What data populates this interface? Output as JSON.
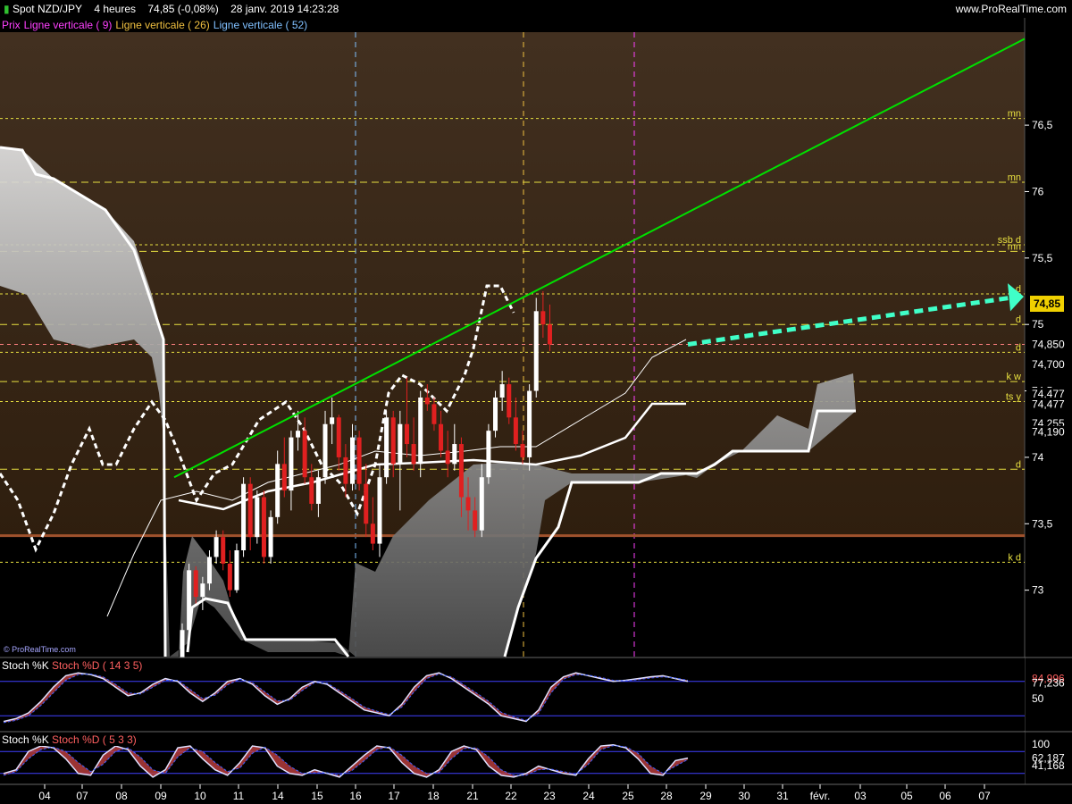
{
  "header": {
    "instrument": "Spot NZD/JPY",
    "timeframe": "4 heures",
    "last": "74,85 (-0,08%)",
    "datetime": "28 janv. 2019 14:23:28",
    "site": "www.ProRealTime.com",
    "watermark": "© ProRealTime.com"
  },
  "legend": [
    {
      "label": "Prix",
      "color": "#ff40ff"
    },
    {
      "label": "Ligne verticale ( 9)",
      "color": "#ff40ff"
    },
    {
      "label": "Ligne verticale ( 26)",
      "color": "#f0c040"
    },
    {
      "label": "Ligne verticale ( 52)",
      "color": "#80c0ff"
    }
  ],
  "current_price_badge": "74,85",
  "colors": {
    "candle_up": "#ffffff",
    "candle_down": "#e02020",
    "trendline": "#00e000",
    "projection_arrow": "#40ffc8",
    "support_line": "#a0522d",
    "level_lines": "#e8e040",
    "cloud": "#c8c8c8"
  },
  "chart_data": [
    {
      "type": "line",
      "panel": "price",
      "ylim": [
        72.5,
        77.2
      ],
      "y_ticks": [
        {
          "value": 76.5,
          "label": "76,5"
        },
        {
          "value": 76,
          "label": "76"
        },
        {
          "value": 75.5,
          "label": "75,5"
        },
        {
          "value": 75,
          "label": "75"
        },
        {
          "value": 74.5,
          "label": "74,5"
        },
        {
          "value": 74,
          "label": "74"
        },
        {
          "value": 73.5,
          "label": "73,5"
        },
        {
          "value": 73,
          "label": "73"
        }
      ],
      "axis_labels": [
        {
          "value": 74.85,
          "label": "74,850"
        },
        {
          "value": 74.7,
          "label": "74,700"
        },
        {
          "value": 74.477,
          "label": "74,477"
        },
        {
          "value": 74.4,
          "label": "74,477"
        },
        {
          "value": 74.255,
          "label": "74,255"
        },
        {
          "value": 74.19,
          "label": "74,190"
        }
      ],
      "level_lines": [
        {
          "value": 76.55,
          "label": "mn"
        },
        {
          "value": 76.07,
          "label": "mn"
        },
        {
          "value": 75.6,
          "label": "ssb d"
        },
        {
          "value": 75.55,
          "label": "mn"
        },
        {
          "value": 75.23,
          "label": "d"
        },
        {
          "value": 75.0,
          "label": "d"
        },
        {
          "value": 74.79,
          "label": "d"
        },
        {
          "value": 74.57,
          "label": "k w"
        },
        {
          "value": 74.42,
          "label": "ts y"
        },
        {
          "value": 73.91,
          "label": "d"
        },
        {
          "value": 73.21,
          "label": "k d"
        }
      ],
      "support_level": 73.41,
      "current_price": 74.85,
      "x_categories": [
        "04",
        "07",
        "08",
        "09",
        "10",
        "11",
        "14",
        "15",
        "16",
        "17",
        "18",
        "21",
        "22",
        "23",
        "24",
        "25",
        "28",
        "29",
        "30",
        "31",
        "févr.",
        "03",
        "05",
        "06",
        "07"
      ],
      "ohlc": [
        [
          72.45,
          72.75,
          72.42,
          72.7
        ],
        [
          72.7,
          73.2,
          72.6,
          73.15
        ],
        [
          73.15,
          73.18,
          72.9,
          72.95
        ],
        [
          72.95,
          73.1,
          72.85,
          73.05
        ],
        [
          73.05,
          73.3,
          73.0,
          73.25
        ],
        [
          73.25,
          73.45,
          73.2,
          73.4
        ],
        [
          73.4,
          73.45,
          73.15,
          73.2
        ],
        [
          73.2,
          73.3,
          72.95,
          73.0
        ],
        [
          73.0,
          73.35,
          72.98,
          73.3
        ],
        [
          73.3,
          73.85,
          73.25,
          73.8
        ],
        [
          73.8,
          73.85,
          73.3,
          73.4
        ],
        [
          73.4,
          73.75,
          73.35,
          73.7
        ],
        [
          73.7,
          73.75,
          73.2,
          73.25
        ],
        [
          73.25,
          73.6,
          73.2,
          73.55
        ],
        [
          73.55,
          74.05,
          73.5,
          73.95
        ],
        [
          73.95,
          74.15,
          73.7,
          73.75
        ],
        [
          73.75,
          74.2,
          73.6,
          74.15
        ],
        [
          74.15,
          74.35,
          74.05,
          74.2
        ],
        [
          74.2,
          74.3,
          73.8,
          73.85
        ],
        [
          73.85,
          73.95,
          73.6,
          73.65
        ],
        [
          73.65,
          73.9,
          73.55,
          73.85
        ],
        [
          73.85,
          74.35,
          73.8,
          74.25
        ],
        [
          74.25,
          74.45,
          74.1,
          74.3
        ],
        [
          74.3,
          74.32,
          73.9,
          74.0
        ],
        [
          74.0,
          74.1,
          73.7,
          73.8
        ],
        [
          73.8,
          74.25,
          73.75,
          74.15
        ],
        [
          74.15,
          74.2,
          73.75,
          73.8
        ],
        [
          73.8,
          73.95,
          73.4,
          73.5
        ],
        [
          73.5,
          73.7,
          73.3,
          73.35
        ],
        [
          73.35,
          73.95,
          73.25,
          73.85
        ],
        [
          73.85,
          74.35,
          73.8,
          74.3
        ],
        [
          74.3,
          74.35,
          73.85,
          73.95
        ],
        [
          73.95,
          74.35,
          73.6,
          74.25
        ],
        [
          74.25,
          74.6,
          74.0,
          74.1
        ],
        [
          74.1,
          74.3,
          73.9,
          73.95
        ],
        [
          73.95,
          74.5,
          73.85,
          74.45
        ],
        [
          74.45,
          74.55,
          74.35,
          74.4
        ],
        [
          74.4,
          74.45,
          74.2,
          74.25
        ],
        [
          74.25,
          74.35,
          74.0,
          74.05
        ],
        [
          74.05,
          74.2,
          73.85,
          73.95
        ],
        [
          73.95,
          74.25,
          73.9,
          74.1
        ],
        [
          74.1,
          74.15,
          73.55,
          73.7
        ],
        [
          73.7,
          73.85,
          73.45,
          73.6
        ],
        [
          73.6,
          73.7,
          73.4,
          73.45
        ],
        [
          73.45,
          73.95,
          73.4,
          73.85
        ],
        [
          73.85,
          74.25,
          73.8,
          74.2
        ],
        [
          74.2,
          74.5,
          74.15,
          74.45
        ],
        [
          74.45,
          74.65,
          74.35,
          74.55
        ],
        [
          74.55,
          74.6,
          74.25,
          74.3
        ],
        [
          74.3,
          74.45,
          74.05,
          74.1
        ],
        [
          74.1,
          74.2,
          73.95,
          74.0
        ],
        [
          74.0,
          74.55,
          73.9,
          74.5
        ],
        [
          74.5,
          75.2,
          74.45,
          75.1
        ],
        [
          75.1,
          75.25,
          74.9,
          75.0
        ],
        [
          75.0,
          75.15,
          74.8,
          74.85
        ]
      ],
      "annotations": [
        {
          "type": "trendline",
          "from": [
            9.4,
            73.85
          ],
          "to": [
            33.0,
            77.15
          ]
        },
        {
          "type": "arrow",
          "from": [
            28.5,
            74.85
          ],
          "to": [
            33.0,
            75.2
          ]
        }
      ]
    },
    {
      "type": "line",
      "panel": "stoch1",
      "title": "Stoch %K",
      "title2": "Stoch %D ( 14 3 5)",
      "ylim": [
        0,
        100
      ],
      "labels": [
        {
          "value": 84.996,
          "label": "84,996"
        },
        {
          "value": 77.236,
          "label": "77,236"
        },
        {
          "value": 50,
          "label": "50"
        }
      ],
      "k": [
        10,
        15,
        25,
        45,
        70,
        90,
        95,
        92,
        85,
        70,
        55,
        60,
        75,
        85,
        80,
        60,
        45,
        60,
        80,
        85,
        75,
        55,
        40,
        50,
        70,
        80,
        75,
        60,
        45,
        30,
        25,
        20,
        40,
        70,
        90,
        95,
        85,
        70,
        55,
        40,
        20,
        15,
        10,
        30,
        70,
        88,
        95,
        90,
        85,
        80,
        82,
        85,
        88,
        90,
        85,
        80
      ],
      "d": [
        8,
        12,
        20,
        38,
        60,
        82,
        92,
        93,
        88,
        75,
        60,
        58,
        70,
        82,
        82,
        66,
        50,
        56,
        74,
        84,
        78,
        62,
        46,
        47,
        64,
        78,
        77,
        64,
        50,
        35,
        28,
        22,
        35,
        62,
        85,
        93,
        88,
        74,
        60,
        45,
        26,
        18,
        12,
        24,
        60,
        84,
        92,
        91,
        87,
        82,
        81,
        83,
        86,
        88,
        86,
        82
      ]
    },
    {
      "type": "line",
      "panel": "stoch2",
      "title": "Stoch %K",
      "title2": "Stoch %D ( 5 3 3)",
      "ylim": [
        0,
        100
      ],
      "labels": [
        {
          "value": 100,
          "label": "100"
        },
        {
          "value": 62.187,
          "label": "62,187"
        },
        {
          "value": 41.168,
          "label": "41,168"
        }
      ],
      "k": [
        20,
        30,
        80,
        95,
        90,
        60,
        20,
        15,
        70,
        95,
        85,
        40,
        10,
        30,
        90,
        95,
        60,
        30,
        15,
        50,
        95,
        90,
        40,
        20,
        15,
        30,
        20,
        10,
        40,
        70,
        95,
        90,
        50,
        20,
        10,
        30,
        80,
        95,
        85,
        40,
        15,
        10,
        20,
        40,
        30,
        20,
        15,
        60,
        95,
        98,
        90,
        60,
        20,
        15,
        55,
        62
      ],
      "d": [
        15,
        25,
        60,
        85,
        92,
        80,
        50,
        25,
        45,
        80,
        90,
        65,
        30,
        20,
        65,
        90,
        80,
        50,
        25,
        35,
        75,
        92,
        70,
        40,
        20,
        22,
        22,
        15,
        28,
        55,
        85,
        93,
        70,
        40,
        20,
        22,
        60,
        88,
        90,
        65,
        30,
        15,
        15,
        30,
        32,
        25,
        18,
        45,
        85,
        96,
        93,
        75,
        40,
        20,
        40,
        58
      ]
    }
  ]
}
